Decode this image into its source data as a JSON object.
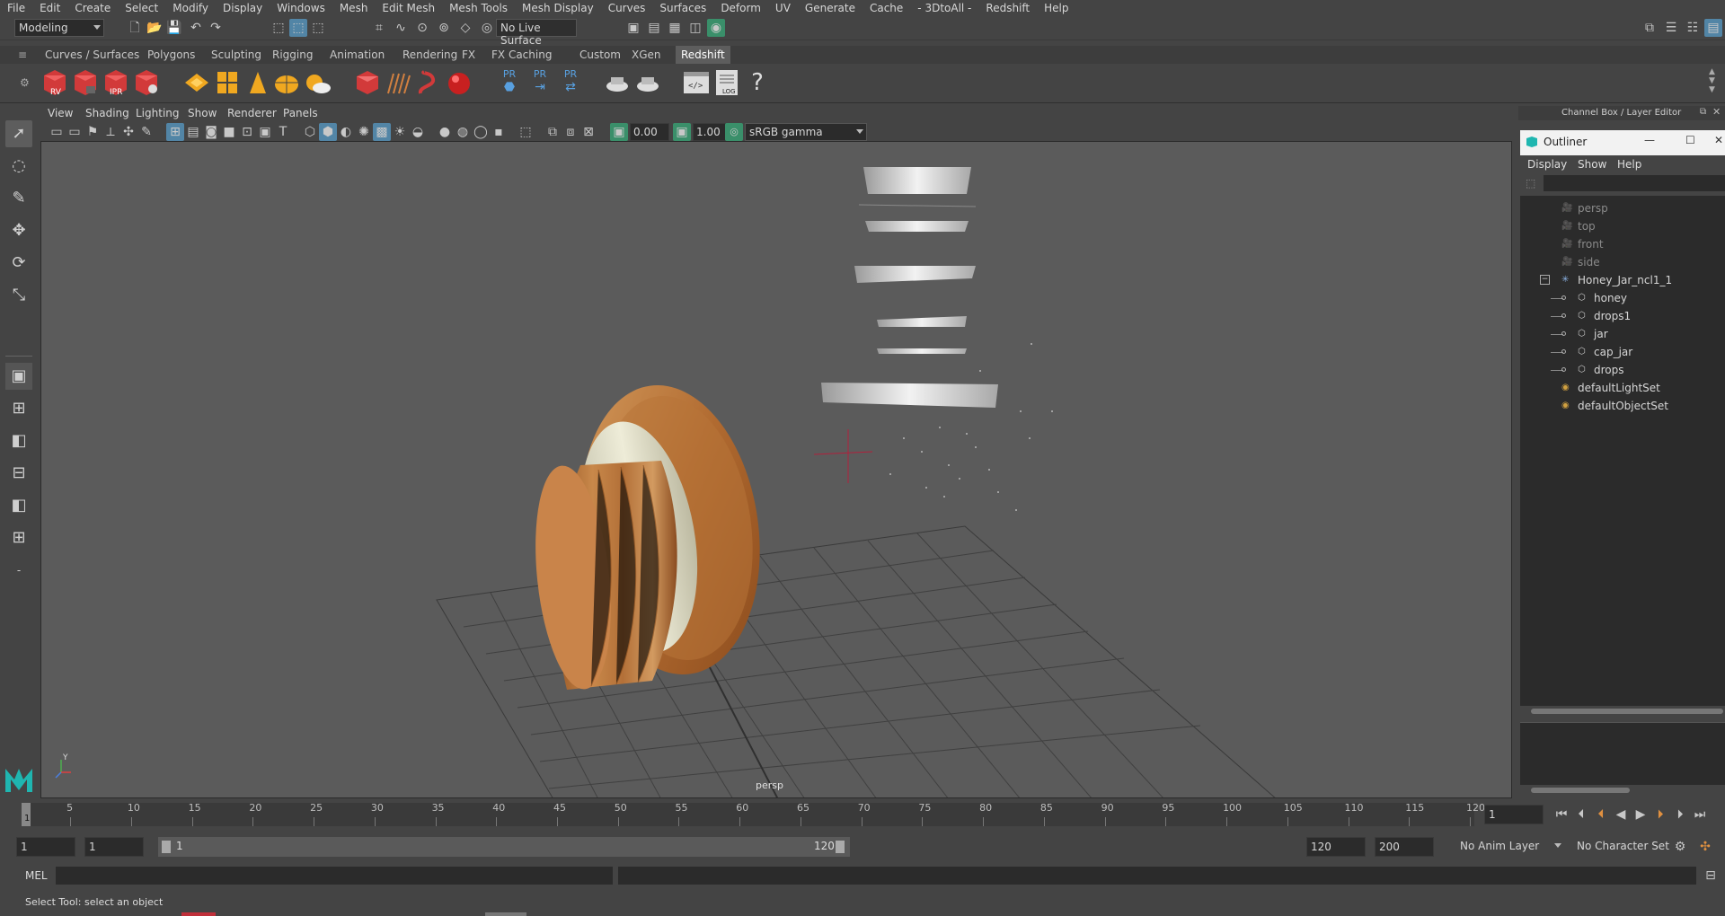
{
  "menu": [
    "File",
    "Edit",
    "Create",
    "Select",
    "Modify",
    "Display",
    "Windows",
    "Mesh",
    "Edit Mesh",
    "Mesh Tools",
    "Mesh Display",
    "Curves",
    "Surfaces",
    "Deform",
    "UV",
    "Generate",
    "Cache",
    "- 3DtoAll -",
    "Redshift",
    "Help"
  ],
  "status": {
    "mode": "Modeling",
    "live_surface": "No Live Surface"
  },
  "shelf_tabs": [
    "Curves / Surfaces",
    "Polygons",
    "Sculpting",
    "Rigging",
    "Animation",
    "Rendering",
    "FX",
    "FX Caching",
    "Custom",
    "XGen",
    "Redshift"
  ],
  "shelf_active_tab": "Redshift",
  "shelf_icon_labels": {
    "rv": "RV",
    "ipr": "IPR",
    "pr1": "PR",
    "pr2": "PR",
    "pr3": "PR",
    "log": "LOG",
    "help": "?"
  },
  "panel_menu": [
    "View",
    "Shading",
    "Lighting",
    "Show",
    "Renderer",
    "Panels"
  ],
  "panel_fields": {
    "exposure": "0.00",
    "gamma": "1.00",
    "colorspace": "sRGB gamma"
  },
  "viewport": {
    "camera_label": "persp",
    "axis_label": "Y"
  },
  "channel_box_title": "Channel Box / Layer Editor",
  "outliner": {
    "title": "Outliner",
    "menu": [
      "Display",
      "Show",
      "Help"
    ],
    "items": [
      {
        "label": "persp",
        "type": "camera",
        "dim": true
      },
      {
        "label": "top",
        "type": "camera",
        "dim": true
      },
      {
        "label": "front",
        "type": "camera",
        "dim": true
      },
      {
        "label": "side",
        "type": "camera",
        "dim": true
      },
      {
        "label": "Honey_Jar_ncl1_1",
        "type": "group",
        "dim": false
      },
      {
        "label": "honey",
        "type": "mesh",
        "dim": false
      },
      {
        "label": "drops1",
        "type": "mesh",
        "dim": false
      },
      {
        "label": "jar",
        "type": "mesh",
        "dim": false
      },
      {
        "label": "cap_jar",
        "type": "mesh",
        "dim": false
      },
      {
        "label": "drops",
        "type": "mesh",
        "dim": false
      },
      {
        "label": "defaultLightSet",
        "type": "set",
        "dim": false
      },
      {
        "label": "defaultObjectSet",
        "type": "set",
        "dim": false
      }
    ]
  },
  "timeline": {
    "ticks": [
      "5",
      "10",
      "15",
      "20",
      "25",
      "30",
      "35",
      "40",
      "45",
      "50",
      "55",
      "60",
      "65",
      "70",
      "75",
      "80",
      "85",
      "90",
      "95",
      "100",
      "105",
      "110",
      "115",
      "120"
    ],
    "start_marker": "1",
    "current_frame": "1"
  },
  "range": {
    "start": "1",
    "playback_start": "1",
    "slider_start": "1",
    "slider_end": "120",
    "playback_end": "120",
    "end": "200",
    "anim_layer": "No Anim Layer",
    "character_set": "No Character Set"
  },
  "cmdline": {
    "label": "MEL"
  },
  "helpline": {
    "text": "Select Tool: select an object"
  },
  "colors": {
    "accent": "#5285a6",
    "redshift_red": "#d23a3a",
    "wood": "#b9763c",
    "cap_white": "#e6e4d2"
  }
}
